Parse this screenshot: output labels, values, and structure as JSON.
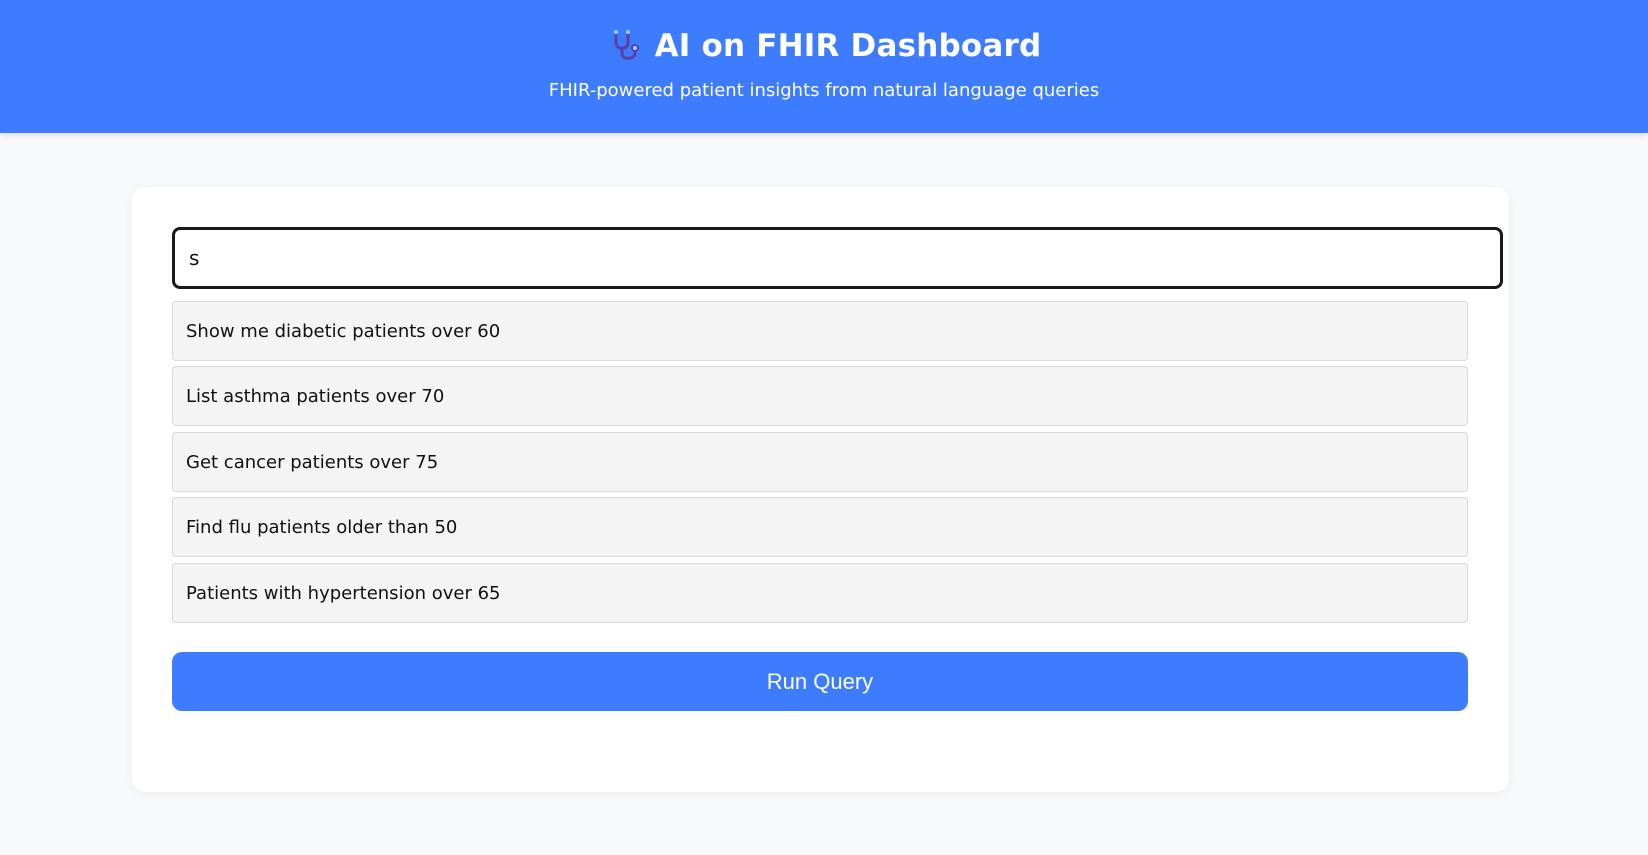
{
  "header": {
    "title": "AI on FHIR Dashboard",
    "subtitle": "FHIR-powered patient insights from natural language queries",
    "logo_icon": "stethoscope-icon",
    "background_color": "#3d7cff"
  },
  "query": {
    "value": "s"
  },
  "suggestions": [
    {
      "label": "Show me diabetic patients over 60"
    },
    {
      "label": "List asthma patients over 70"
    },
    {
      "label": "Get cancer patients over 75"
    },
    {
      "label": "Find flu patients older than 50"
    },
    {
      "label": "Patients with hypertension over 65"
    }
  ],
  "actions": {
    "run_label": "Run Query",
    "button_color": "#3d7cff"
  }
}
